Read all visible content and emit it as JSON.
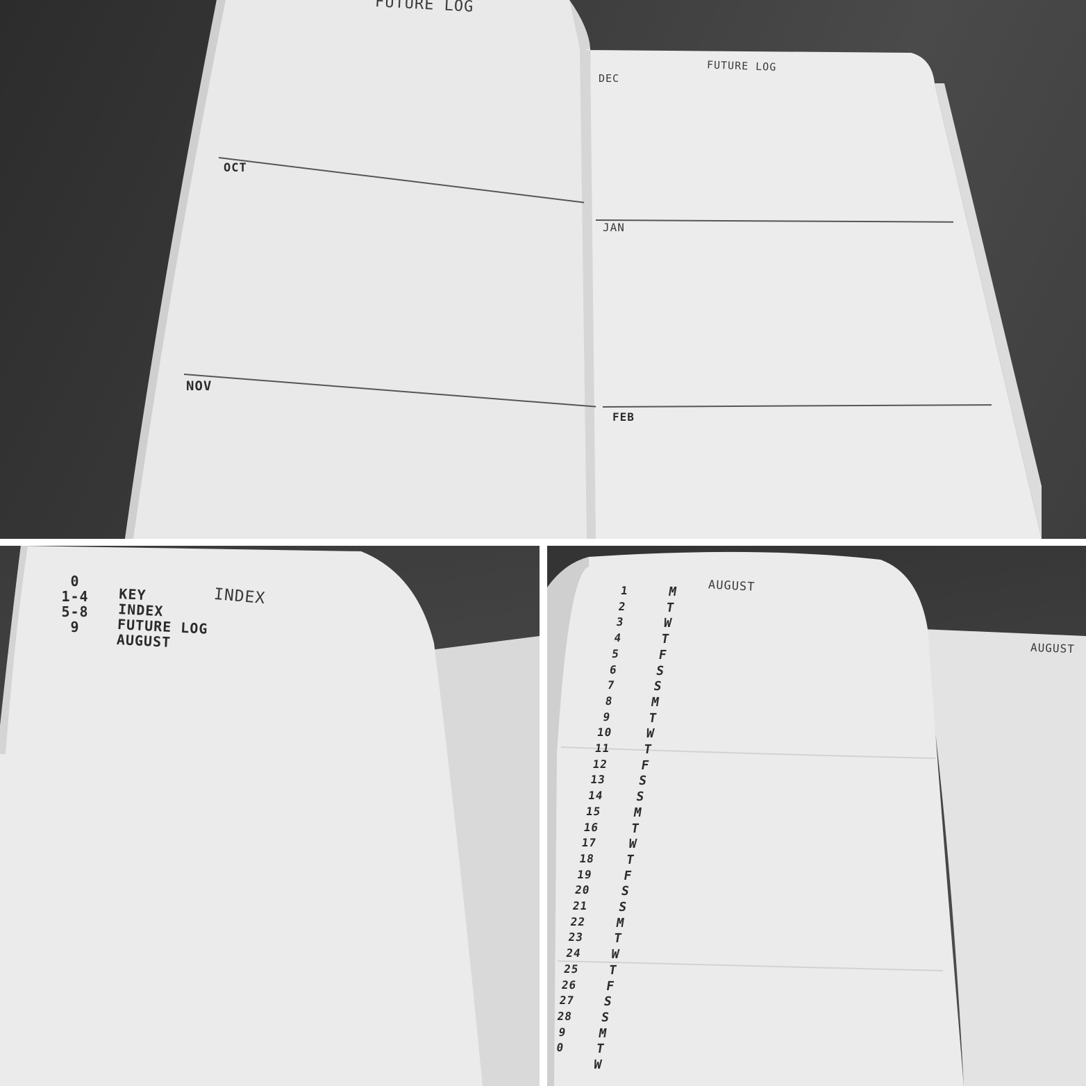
{
  "collage": {
    "top_spread": {
      "left_page": {
        "title": "FUTURE LOG",
        "sections": [
          "OCT",
          "NOV"
        ]
      },
      "right_page": {
        "title": "FUTURE LOG",
        "sections": [
          "DEC",
          "JAN",
          "FEB"
        ]
      }
    },
    "index_spread": {
      "page_numbers": [
        "0",
        "1-4",
        "5-8",
        "9"
      ],
      "entries": [
        "KEY",
        "INDEX",
        "FUTURE LOG",
        "AUGUST"
      ],
      "title": "INDEX"
    },
    "august_spread": {
      "left_title": "AUGUST",
      "right_title": "AUGUST",
      "dates": [
        "1",
        "2",
        "3",
        "4",
        "5",
        "6",
        "7",
        "8",
        "9",
        "10",
        "11",
        "12",
        "13",
        "14",
        "15",
        "16",
        "17",
        "18",
        "19",
        "20",
        "21",
        "22",
        "23",
        "24",
        "25",
        "26",
        "27",
        "28",
        "9",
        "0",
        ""
      ],
      "weekdays": [
        "M",
        "T",
        "W",
        "T",
        "F",
        "S",
        "S",
        "M",
        "T",
        "W",
        "T",
        "F",
        "S",
        "S",
        "M",
        "T",
        "W",
        "T",
        "F",
        "S",
        "S",
        "M",
        "T",
        "W",
        "T",
        "F",
        "S",
        "S",
        "M",
        "T",
        "W"
      ]
    }
  }
}
